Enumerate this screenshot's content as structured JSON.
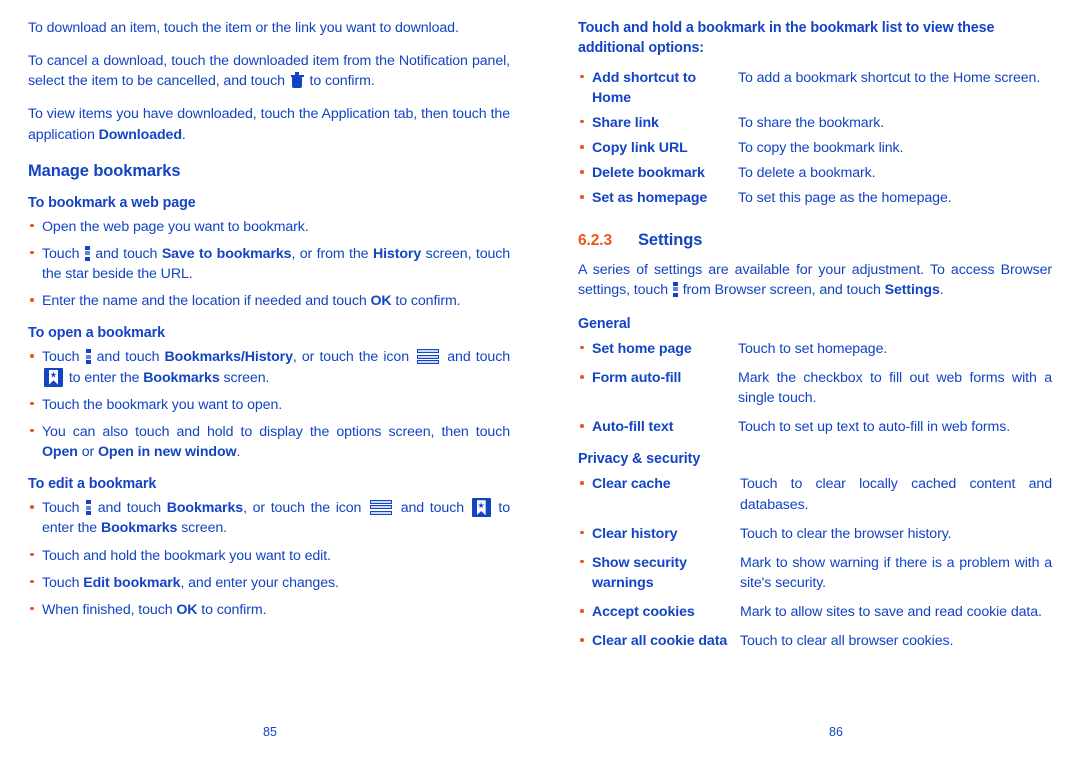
{
  "document": {
    "text_color": "#1344c4",
    "bullet_color": "#e8581e"
  },
  "left_page": {
    "number": "85",
    "paragraphs": {
      "p1": "To download an item, touch the item or the link you want to download.",
      "p2_a": "To cancel a download, touch the downloaded item from the Notification panel, select the item to be cancelled, and touch",
      "p2_b": "to confirm.",
      "p3_a": "To view items you have downloaded, touch the Application tab, then touch the application",
      "p3_bold": "Downloaded",
      "p3_c": "."
    },
    "section_title": "Manage bookmarks",
    "sub1": {
      "title": "To bookmark a web page",
      "items": {
        "i1": "Open the web page you want to bookmark.",
        "i2_a": "Touch",
        "i2_b": "and touch",
        "i2_bold1": "Save to bookmarks",
        "i2_c": ", or from the",
        "i2_bold2": "History",
        "i2_d": "screen, touch the star beside the URL.",
        "i3_a": "Enter the name and the location if needed and touch",
        "i3_bold": "OK",
        "i3_b": "to confirm."
      }
    },
    "sub2": {
      "title": "To open a bookmark",
      "items": {
        "i1_a": "Touch",
        "i1_b": "and touch",
        "i1_bold1": "Bookmarks/History",
        "i1_c": ", or touch the icon",
        "i1_d": "and touch",
        "i1_e": "to enter the",
        "i1_bold2": "Bookmarks",
        "i1_f": "screen.",
        "i2": "Touch the bookmark you want to open.",
        "i3_a": "You can also touch and hold to display the options screen, then touch",
        "i3_bold1": "Open",
        "i3_b": "or",
        "i3_bold2": "Open in new window",
        "i3_c": "."
      }
    },
    "sub3": {
      "title": "To edit a bookmark",
      "items": {
        "i1_a": "Touch",
        "i1_b": "and touch",
        "i1_bold1": "Bookmarks",
        "i1_c": ", or touch the icon",
        "i1_d": "and touch",
        "i1_e": "to enter the",
        "i1_bold2": "Bookmarks",
        "i1_f": "screen.",
        "i2": "Touch and hold the bookmark you want to edit.",
        "i3_a": "Touch",
        "i3_bold": "Edit bookmark",
        "i3_b": ", and enter your changes.",
        "i4_a": "When finished, touch",
        "i4_bold": "OK",
        "i4_b": "to confirm."
      }
    }
  },
  "right_page": {
    "number": "86",
    "intro_heading": "Touch and hold a bookmark in the bookmark list to view these additional options:",
    "bookmark_options": [
      {
        "term": "Add shortcut to Home",
        "desc": "To add a bookmark shortcut to the Home screen."
      },
      {
        "term": "Share link",
        "desc": "To share the bookmark."
      },
      {
        "term": "Copy link URL",
        "desc": "To copy the bookmark link."
      },
      {
        "term": "Delete bookmark",
        "desc": "To delete a bookmark."
      },
      {
        "term": "Set as homepage",
        "desc": "To set this page as the homepage."
      }
    ],
    "settings_heading": {
      "number": "6.2.3",
      "title": "Settings"
    },
    "settings_intro": {
      "a": "A series of settings are available for your adjustment. To access Browser settings, touch",
      "b": "from Browser screen, and touch",
      "bold": "Settings",
      "c": "."
    },
    "general": {
      "heading": "General",
      "items": [
        {
          "term": "Set home page",
          "desc": "Touch to set homepage."
        },
        {
          "term": "Form auto-fill",
          "desc": "Mark the checkbox to fill out web forms with a single touch."
        },
        {
          "term": "Auto-fill text",
          "desc": "Touch to set up text to auto-fill in web forms."
        }
      ]
    },
    "privacy": {
      "heading": "Privacy & security",
      "items": [
        {
          "term": "Clear cache",
          "desc": "Touch to clear locally cached content and databases."
        },
        {
          "term": "Clear history",
          "desc": "Touch to clear the browser history."
        },
        {
          "term": "Show security warnings",
          "desc": "Mark to show warning if there is a problem with a site's security."
        },
        {
          "term": "Accept cookies",
          "desc": "Mark to allow sites to save and read cookie data."
        },
        {
          "term": "Clear all cookie data",
          "desc": "Touch to clear all browser cookies."
        }
      ]
    }
  }
}
